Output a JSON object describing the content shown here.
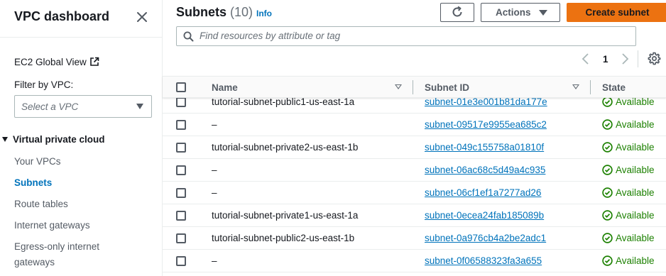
{
  "sidebar": {
    "title": "VPC dashboard",
    "ec2_global_view": "EC2 Global View",
    "filter_label": "Filter by VPC:",
    "filter_placeholder": "Select a VPC",
    "section_label": "Virtual private cloud",
    "items": [
      {
        "label": "Your VPCs"
      },
      {
        "label": "Subnets"
      },
      {
        "label": "Route tables"
      },
      {
        "label": "Internet gateways"
      },
      {
        "label": "Egress-only internet"
      },
      {
        "label": "gateways"
      }
    ]
  },
  "header": {
    "title": "Subnets",
    "count": "(10)",
    "info": "Info",
    "actions_label": "Actions",
    "create_label": "Create subnet"
  },
  "search": {
    "placeholder": "Find resources by attribute or tag"
  },
  "pagination": {
    "current_page": "1"
  },
  "table": {
    "columns": [
      "Name",
      "Subnet ID",
      "State"
    ],
    "rows": [
      {
        "name": "tutorial-subnet-public1-us-east-1a",
        "subnet_id": "subnet-01e3e001b81da177e",
        "state": "Available"
      },
      {
        "name": "–",
        "subnet_id": "subnet-09517e9955ea685c2",
        "state": "Available"
      },
      {
        "name": "tutorial-subnet-private2-us-east-1b",
        "subnet_id": "subnet-049c155758a01810f",
        "state": "Available"
      },
      {
        "name": "–",
        "subnet_id": "subnet-06ac68c5d49a4c935",
        "state": "Available"
      },
      {
        "name": "–",
        "subnet_id": "subnet-06cf1ef1a7277ad26",
        "state": "Available"
      },
      {
        "name": "tutorial-subnet-private1-us-east-1a",
        "subnet_id": "subnet-0ecea24fab185089b",
        "state": "Available"
      },
      {
        "name": "tutorial-subnet-public2-us-east-1b",
        "subnet_id": "subnet-0a976cb4a2be2adc1",
        "state": "Available"
      },
      {
        "name": "–",
        "subnet_id": "subnet-0f06588323fa3a655",
        "state": "Available"
      }
    ]
  },
  "colors": {
    "primary_button": "#ec7211",
    "link": "#0073bb",
    "status_available": "#1d8102"
  },
  "icons": [
    "close-icon",
    "external-link-icon",
    "chevron-down-icon",
    "refresh-icon",
    "search-icon",
    "chevron-left-icon",
    "chevron-right-icon",
    "gear-icon",
    "sort-icon",
    "check-circle-icon"
  ]
}
